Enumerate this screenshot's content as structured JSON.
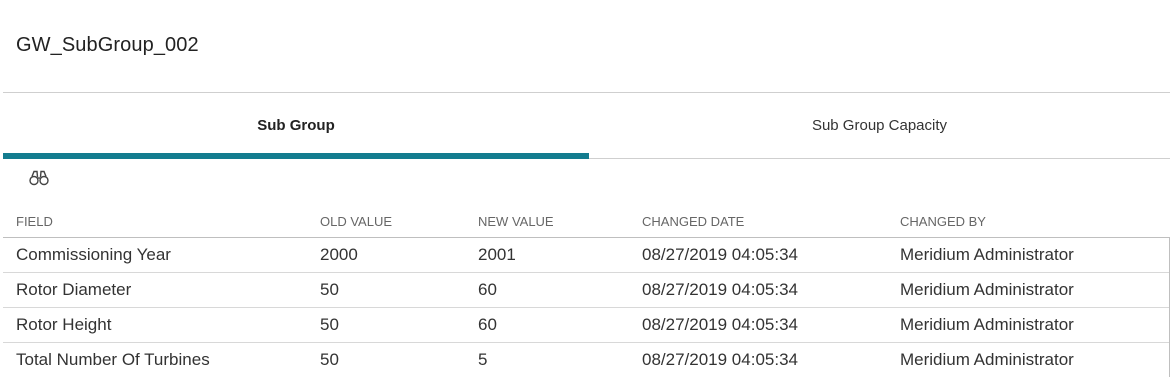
{
  "page": {
    "title": "GW_SubGroup_002"
  },
  "tabs": [
    {
      "label": "Sub Group",
      "active": true
    },
    {
      "label": "Sub Group Capacity",
      "active": false
    }
  ],
  "toolbar": {
    "search_icon": "binoculars-icon"
  },
  "table": {
    "columns": [
      "FIELD",
      "OLD VALUE",
      "NEW VALUE",
      "CHANGED DATE",
      "CHANGED BY"
    ],
    "rows": [
      [
        "Commissioning Year",
        "2000",
        "2001",
        "08/27/2019 04:05:34",
        "Meridium Administrator"
      ],
      [
        "Rotor Diameter",
        "50",
        "60",
        "08/27/2019 04:05:34",
        "Meridium Administrator"
      ],
      [
        "Rotor Height",
        "50",
        "60",
        "08/27/2019 04:05:34",
        "Meridium Administrator"
      ],
      [
        "Total Number Of Turbines",
        "50",
        "5",
        "08/27/2019 04:05:34",
        "Meridium Administrator"
      ]
    ]
  },
  "colors": {
    "accent": "#137c8f"
  }
}
